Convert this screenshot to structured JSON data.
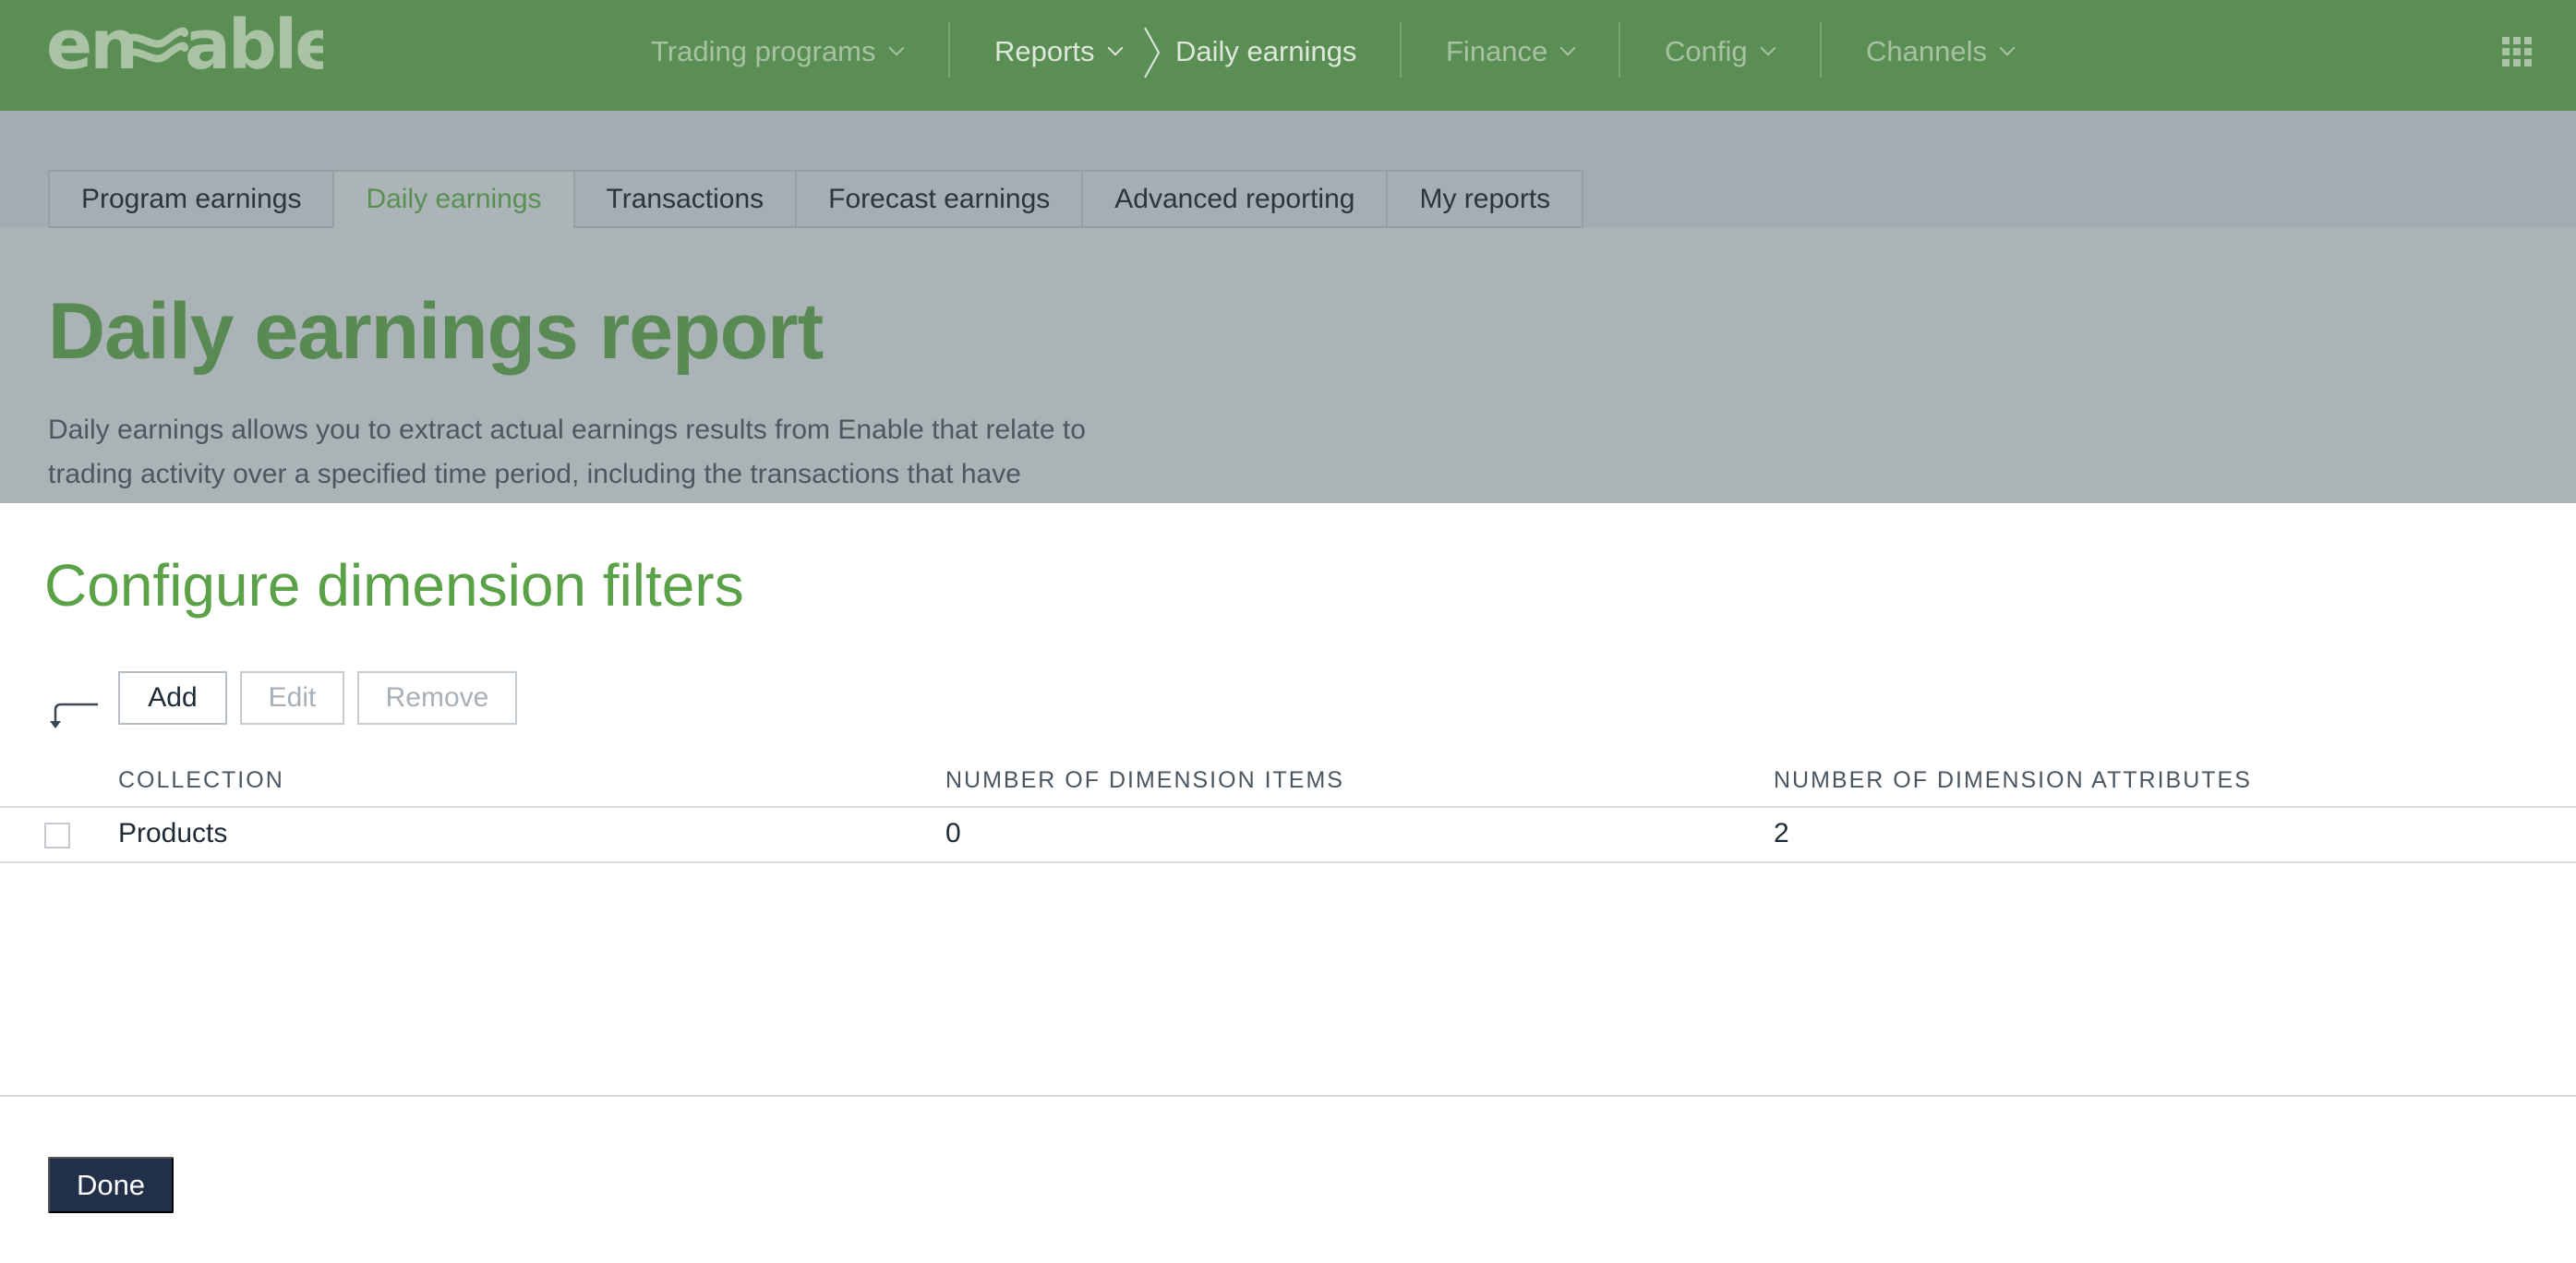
{
  "app": {
    "logo_text": "enable"
  },
  "nav": {
    "items": [
      {
        "label": "Trading programs",
        "has_dropdown": true
      },
      {
        "label": "Reports",
        "has_dropdown": true
      },
      {
        "label": "Daily earnings",
        "has_dropdown": false
      },
      {
        "label": "Finance",
        "has_dropdown": true
      },
      {
        "label": "Config",
        "has_dropdown": true
      },
      {
        "label": "Channels",
        "has_dropdown": true
      }
    ],
    "apps_icon": "grid-icon"
  },
  "tabs": [
    {
      "label": "Program earnings",
      "active": false
    },
    {
      "label": "Daily earnings",
      "active": true
    },
    {
      "label": "Transactions",
      "active": false
    },
    {
      "label": "Forecast earnings",
      "active": false
    },
    {
      "label": "Advanced reporting",
      "active": false
    },
    {
      "label": "My reports",
      "active": false
    }
  ],
  "page": {
    "title": "Daily earnings report",
    "description": "Daily earnings allows you to extract actual earnings results from Enable that relate to trading activity over a specified time period, including the transactions that have"
  },
  "modal": {
    "title": "Configure dimension filters",
    "buttons": {
      "add": "Add",
      "edit": "Edit",
      "remove": "Remove"
    },
    "table": {
      "columns": [
        "COLLECTION",
        "NUMBER OF DIMENSION ITEMS",
        "NUMBER OF DIMENSION ATTRIBUTES"
      ],
      "rows": [
        {
          "collection": "Products",
          "items": "0",
          "attributes": "2",
          "checked": false
        }
      ]
    },
    "done_label": "Done"
  },
  "colors": {
    "topbar": "#5b8e55",
    "accent_green": "#5aa147",
    "primary_button": "#22304a"
  }
}
